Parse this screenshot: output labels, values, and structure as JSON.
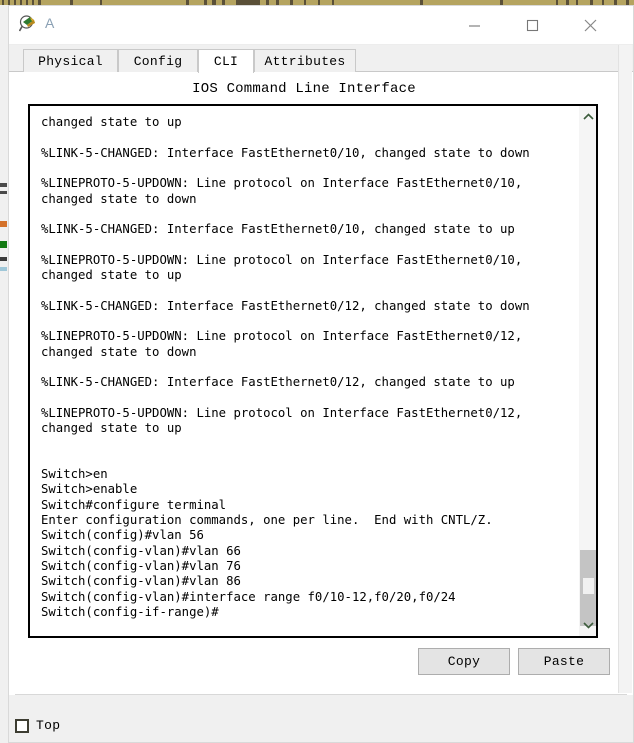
{
  "window": {
    "title": "A",
    "icon": "packet-tracer-device-icon",
    "controls": {
      "minimize": "—",
      "maximize": "□",
      "close": "✕"
    }
  },
  "tabs": [
    {
      "label": "Physical",
      "active": false
    },
    {
      "label": "Config",
      "active": false
    },
    {
      "label": "CLI",
      "active": true
    },
    {
      "label": "Attributes",
      "active": false
    }
  ],
  "cli": {
    "heading": "IOS Command Line Interface",
    "output": "changed state to up\n\n%LINK-5-CHANGED: Interface FastEthernet0/10, changed state to down\n\n%LINEPROTO-5-UPDOWN: Line protocol on Interface FastEthernet0/10, changed state to down\n\n%LINK-5-CHANGED: Interface FastEthernet0/10, changed state to up\n\n%LINEPROTO-5-UPDOWN: Line protocol on Interface FastEthernet0/10, changed state to up\n\n%LINK-5-CHANGED: Interface FastEthernet0/12, changed state to down\n\n%LINEPROTO-5-UPDOWN: Line protocol on Interface FastEthernet0/12, changed state to down\n\n%LINK-5-CHANGED: Interface FastEthernet0/12, changed state to up\n\n%LINEPROTO-5-UPDOWN: Line protocol on Interface FastEthernet0/12, changed state to up\n\n\nSwitch>en\nSwitch>enable\nSwitch#configure terminal\nEnter configuration commands, one per line.  End with CNTL/Z.\nSwitch(config)#vlan 56\nSwitch(config-vlan)#vlan 66\nSwitch(config-vlan)#vlan 76\nSwitch(config-vlan)#vlan 86\nSwitch(config-vlan)#interface range f0/10-12,f0/20,f0/24\nSwitch(config-if-range)#"
  },
  "buttons": {
    "copy": "Copy",
    "paste": "Paste"
  },
  "footer": {
    "top_checkbox_label": "Top",
    "top_checked": false
  },
  "colors": {
    "background_strip": "#b5a460",
    "tab_bar": "#f0f0f0",
    "terminal_border": "#000000",
    "scrollbar_thumb": "#c4c4c4",
    "button_face": "#e4e4e4",
    "title_text": "#8aa0b4"
  }
}
